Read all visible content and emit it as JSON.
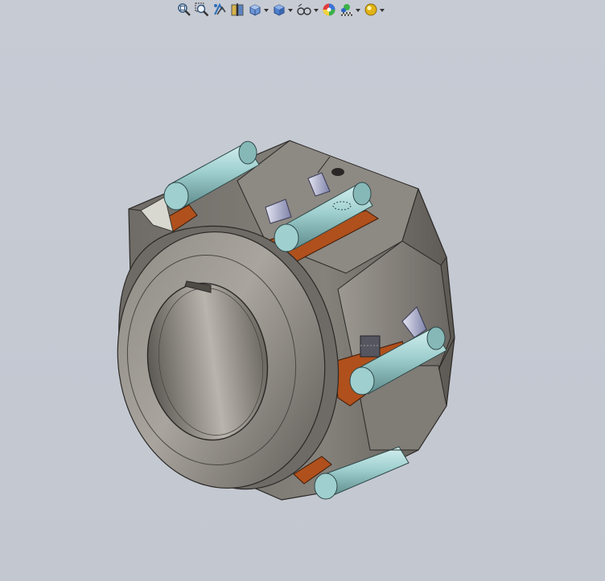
{
  "toolbar": {
    "items": [
      {
        "id": "zoom-to-fit",
        "icon": "zoom-to-fit-icon",
        "dropdown": false
      },
      {
        "id": "zoom-to-area",
        "icon": "zoom-to-area-icon",
        "dropdown": false
      },
      {
        "id": "previous-view",
        "icon": "previous-view-icon",
        "dropdown": false
      },
      {
        "id": "section-view",
        "icon": "section-view-icon",
        "dropdown": false
      },
      {
        "id": "view-orientation",
        "icon": "view-orientation-icon",
        "dropdown": true
      },
      {
        "id": "display-style",
        "icon": "display-style-icon",
        "dropdown": true
      },
      {
        "id": "hide-show-items",
        "icon": "hide-show-items-icon",
        "dropdown": true
      },
      {
        "id": "edit-appearance",
        "icon": "edit-appearance-icon",
        "dropdown": false
      },
      {
        "id": "apply-scene",
        "icon": "apply-scene-icon",
        "dropdown": true
      },
      {
        "id": "view-settings",
        "icon": "view-settings-icon",
        "dropdown": true
      }
    ]
  },
  "colors": {
    "background": "#c5c9d2",
    "hub": "#7a7670",
    "hub_dark": "#5e5a55",
    "hub_light": "#a19c96",
    "pin": "#9fcfcf",
    "pin_dark": "#6f9e9e",
    "shoe": "#b0501c",
    "bolt": "#a8aac8"
  },
  "model": {
    "name": "coupling-hub-assembly"
  }
}
